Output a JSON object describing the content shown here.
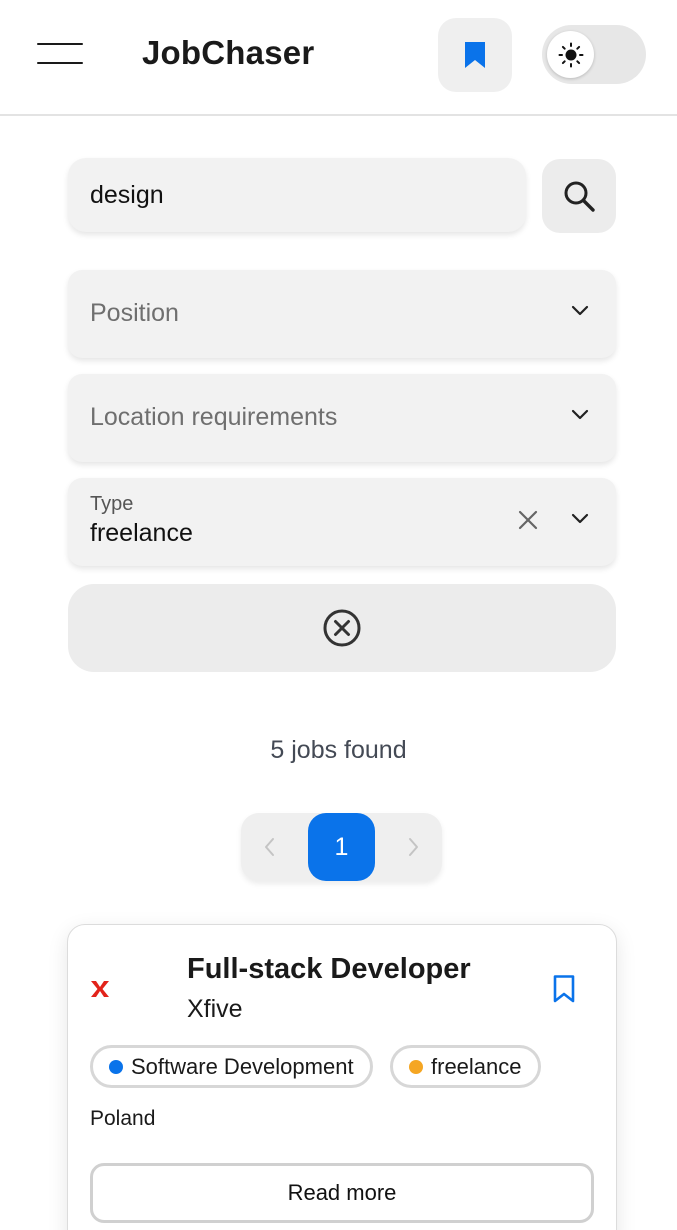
{
  "header": {
    "brand": "JobChaser",
    "colors": {
      "accent": "#0a73ea",
      "background": "#ffffff",
      "control_bg": "#efefef"
    },
    "icons": {
      "menu": "hamburger-icon",
      "bookmarks": "bookmark-icon",
      "theme": "sun-icon"
    },
    "theme_toggle": {
      "mode": "light"
    }
  },
  "search": {
    "value": "design",
    "button_icon": "search-icon"
  },
  "filters": {
    "position": {
      "placeholder": "Position"
    },
    "location": {
      "placeholder": "Location requirements"
    },
    "type": {
      "label": "Type",
      "value": "freelance"
    },
    "reset_icon": "circle-x-icon"
  },
  "results": {
    "count_text": "5 jobs found"
  },
  "pagination": {
    "current_page": "1",
    "prev_icon": "chevron-left-icon",
    "next_icon": "chevron-right-icon"
  },
  "jobs": [
    {
      "title": "Full-stack Developer",
      "company": "Xfive",
      "logo_icon": "xfive-logo",
      "tags": [
        {
          "label": "Software Development",
          "dot_color": "#0a73ea"
        },
        {
          "label": "freelance",
          "dot_color": "#f5a623"
        }
      ],
      "location": "Poland",
      "read_more_label": "Read more"
    }
  ]
}
